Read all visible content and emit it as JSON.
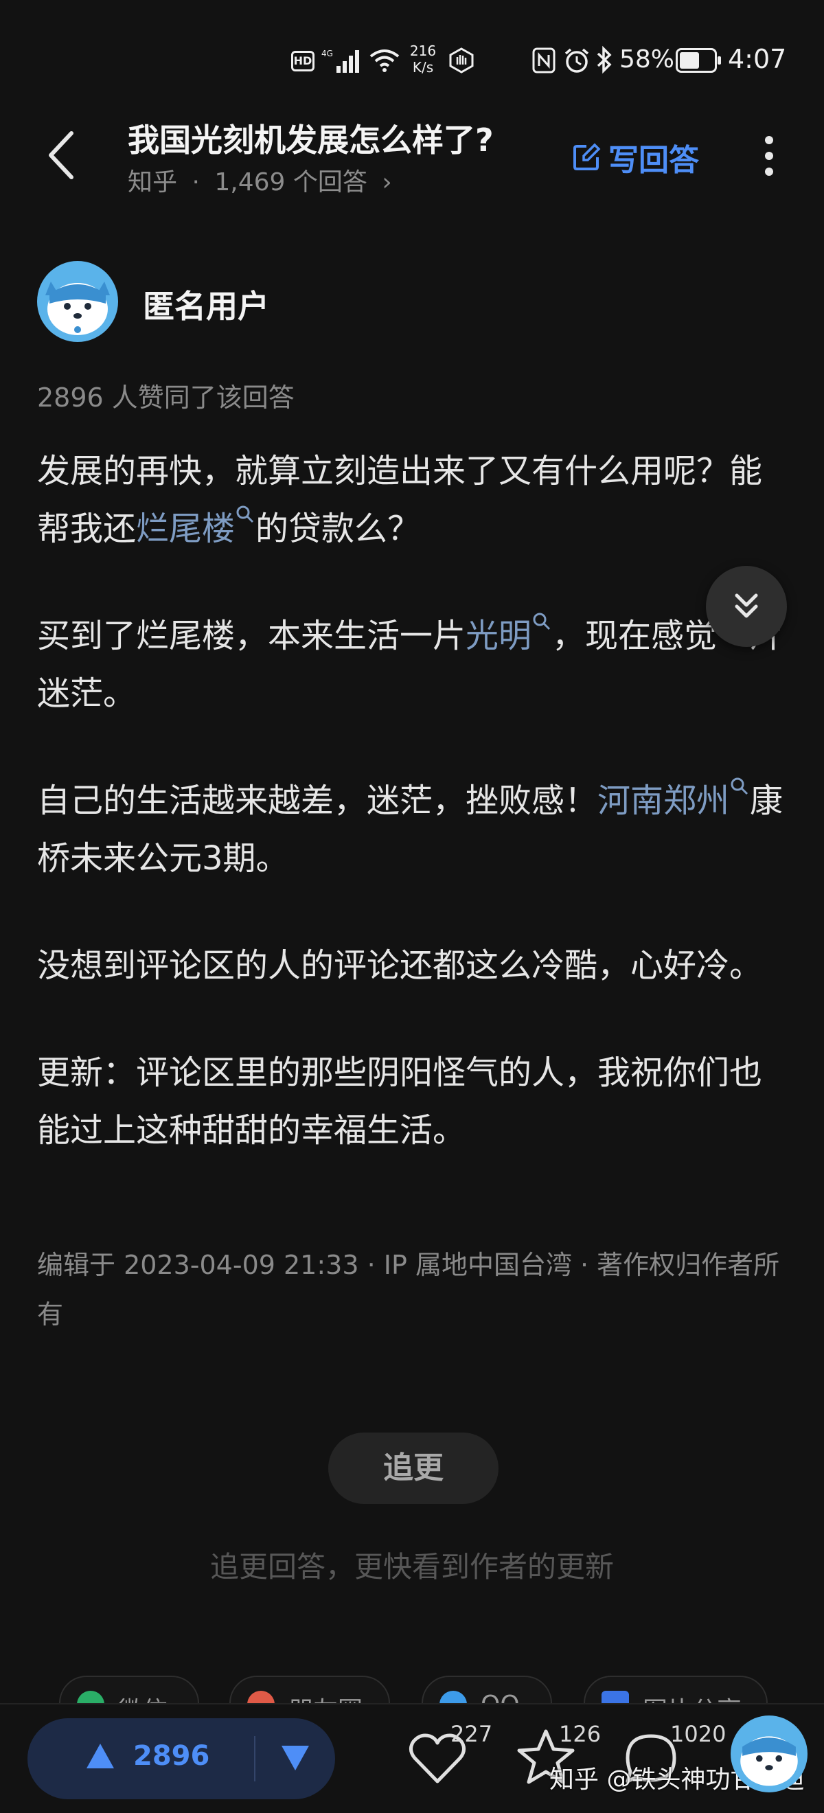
{
  "status_bar": {
    "hd": "HD",
    "network": "4G",
    "speed_value": "216",
    "speed_unit": "K/s",
    "battery_percent": "58%",
    "battery_level": 0.58,
    "time": "4:07"
  },
  "header": {
    "title": "我国光刻机发展怎么样了?",
    "source": "知乎",
    "separator": "·",
    "answers_count": "1,469 个回答",
    "chevron": "›",
    "write_answer_label": "写回答"
  },
  "author": {
    "name": "匿名用户"
  },
  "upvote_summary": "2896 人赞同了该回答",
  "content": {
    "p1_a": "发展的再快，就算立刻造出来了又有什么用呢？能帮我还",
    "p1_link": "烂尾楼",
    "p1_b": "的贷款么？",
    "p2_a": "买到了烂尾楼，本来生活一片",
    "p2_link": "光明",
    "p2_b": "，现在感觉一片迷茫。",
    "p3_a": "自己的生活越来越差，迷茫，挫败感！",
    "p3_link": "河南郑州",
    "p3_b": "康桥未来公元3期。",
    "p4": "没想到评论区的人的评论还都这么冷酷，心好冷。",
    "p5": "更新：评论区里的那些阴阳怪气的人，我祝你们也能过上这种甜甜的幸福生活。"
  },
  "meta": "编辑于 2023-04-09 21:33 · IP 属地中国台湾 · 著作权归作者所有",
  "follow": {
    "button_label": "追更",
    "hint": "追更回答，更快看到作者的更新"
  },
  "share": {
    "items": [
      {
        "label": "微信",
        "color": "#2aae67"
      },
      {
        "label": "朋友圈",
        "color": "#e05a47"
      },
      {
        "label": "QQ",
        "color": "#3d9be9"
      },
      {
        "label": "图片分享",
        "color": "#3b74e6"
      }
    ]
  },
  "bottom_bar": {
    "upvote_count": "2896",
    "like_count": "227",
    "favorite_count": "126",
    "comment_count": "1020",
    "watermark": "知乎 @铁头神功甘乃迪"
  },
  "colors": {
    "background": "#121212",
    "accent": "#4e8ef7",
    "link": "#7e9cc3",
    "muted": "#8a8a8a"
  },
  "icons": [
    "back-icon",
    "edit-icon",
    "more-icon",
    "collapse-icon",
    "upvote-icon",
    "downvote-icon",
    "heart-icon",
    "star-icon",
    "comment-icon",
    "search-icon"
  ]
}
